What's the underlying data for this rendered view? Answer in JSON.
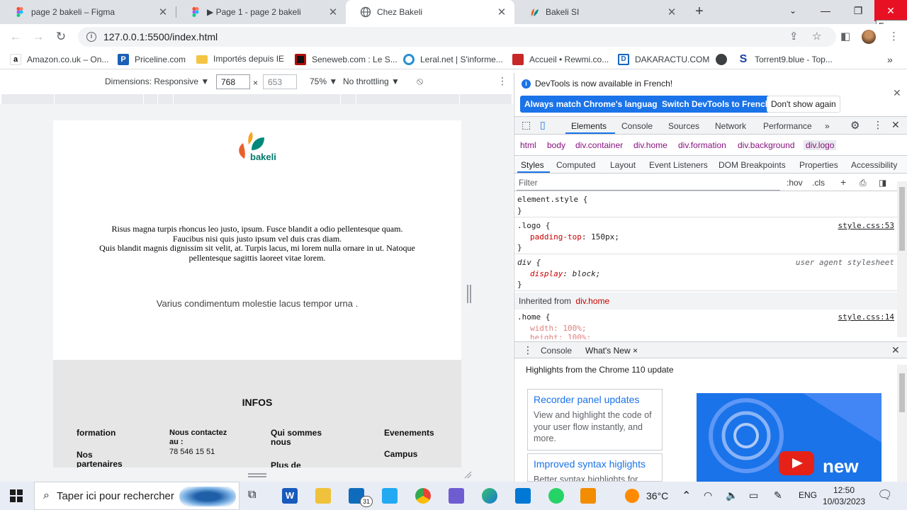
{
  "browser": {
    "tabs": [
      {
        "title": "page 2 bakeli – Figma",
        "icon": "figma-icon",
        "active": false
      },
      {
        "title": "▶ Page 1 - page 2 bakeli",
        "icon": "figma-icon",
        "active": false
      },
      {
        "title": "Chez Bakeli",
        "icon": "globe-icon",
        "active": true
      },
      {
        "title": "Bakeli SI",
        "icon": "bakeli-icon",
        "active": false
      }
    ],
    "close_tooltip": "Fermer",
    "url": "127.0.0.1:5500/index.html",
    "bookmarks": [
      {
        "label": "Amazon.co.uk – On...",
        "icon": "amazon-icon",
        "color": "#ff9900"
      },
      {
        "label": "Priceline.com",
        "icon": "priceline-icon",
        "color": "#1b5fb6"
      },
      {
        "label": "Importés depuis IE",
        "icon": "folder-icon",
        "color": "#f4c542"
      },
      {
        "label": "Seneweb.com : Le S...",
        "icon": "seneweb-icon",
        "color": "#b20d0d"
      },
      {
        "label": "Leral.net | S'informe...",
        "icon": "leral-icon",
        "color": "#2a8fd3"
      },
      {
        "label": "Accueil • Rewmi.co...",
        "icon": "rewmi-icon",
        "color": "#c62828"
      },
      {
        "label": "DAKARACTU.COM",
        "icon": "dakaractu-icon",
        "color": "#1565c0"
      },
      {
        "label": "",
        "icon": "globe-icon",
        "color": "#3c4043"
      },
      {
        "label": "Torrent9.blue - Top...",
        "icon": "torrent-icon",
        "color": "#1a3fa8"
      }
    ]
  },
  "device_toolbar": {
    "dimensions_label": "Dimensions: Responsive ▼",
    "width": "768",
    "height": "653",
    "times": "×",
    "zoom": "75% ▼",
    "throttling": "No throttling ▼"
  },
  "site": {
    "paragraph_lines": [
      "Risus magna turpis rhoncus leo justo, ipsum. Fusce blandit a odio pellentesque quam.",
      "Faucibus nisi quis justo ipsum vel duis cras diam.",
      "Quis blandit magnis dignissim sit velit, at. Turpis lacus, mi lorem nulla ornare in ut. Natoque",
      "pellentesque sagittis laoreet vitae lorem."
    ],
    "subtitle": "Varius condimentum molestie lacus tempor urna .",
    "infos_title": "INFOS",
    "infos": {
      "formation": "formation",
      "nos_partenaires": "Nos partenaires",
      "nous_contactez": "Nous contactez au :",
      "phone": "78 546 15 51",
      "qui_sommes_nous": "Qui sommes nous",
      "plus_de": "Plus de",
      "evenements": "Evenements",
      "campus": "Campus"
    },
    "logo_text": "bakeli"
  },
  "devtools": {
    "banner_message": "DevTools is now available in French!",
    "btn_match": "Always match Chrome's language",
    "btn_switch": "Switch DevTools to French",
    "btn_dont_show": "Don't show again",
    "tabs": [
      "Elements",
      "Console",
      "Sources",
      "Network",
      "Performance",
      "»"
    ],
    "breadcrumbs": [
      "html",
      "body",
      "div.container",
      "div.home",
      "div.formation",
      "div.background",
      "div.logo"
    ],
    "subtabs": [
      "Styles",
      "Computed",
      "Layout",
      "Event Listeners",
      "DOM Breakpoints",
      "Properties",
      "Accessibility"
    ],
    "filter_placeholder": "Filter",
    "hov": ":hov",
    "cls": ".cls",
    "rules": {
      "element_style": "element.style {",
      "close": "}",
      "logo_selector": ".logo {",
      "logo_prop": "padding-top",
      "logo_val": ": 150px;",
      "logo_src": "style.css:53",
      "div_selector": "div {",
      "div_prop": "display",
      "div_val": ": block;",
      "div_src": "user agent stylesheet",
      "inherited_label": "Inherited from",
      "inherited_from": "div.home",
      "home_selector": ".home {",
      "home_src": "style.css:14",
      "home_width": "width: 100%;",
      "home_height": "height: 100%;"
    },
    "drawer_tabs": [
      "Console",
      "What's New ×"
    ],
    "whatsnew_heading": "Highlights from the Chrome 110 update",
    "cards": [
      {
        "title": "Recorder panel updates",
        "desc": "View and highlight the code of your user flow instantly, and more."
      },
      {
        "title": "Improved syntax higlights",
        "desc": "Better syntax highlights for"
      }
    ],
    "video_text": "new"
  },
  "taskbar": {
    "search_placeholder": "Taper ici pour rechercher",
    "mail_badge": "31",
    "temperature": "36°C",
    "language": "ENG",
    "time": "12:50",
    "date": "10/03/2023"
  }
}
